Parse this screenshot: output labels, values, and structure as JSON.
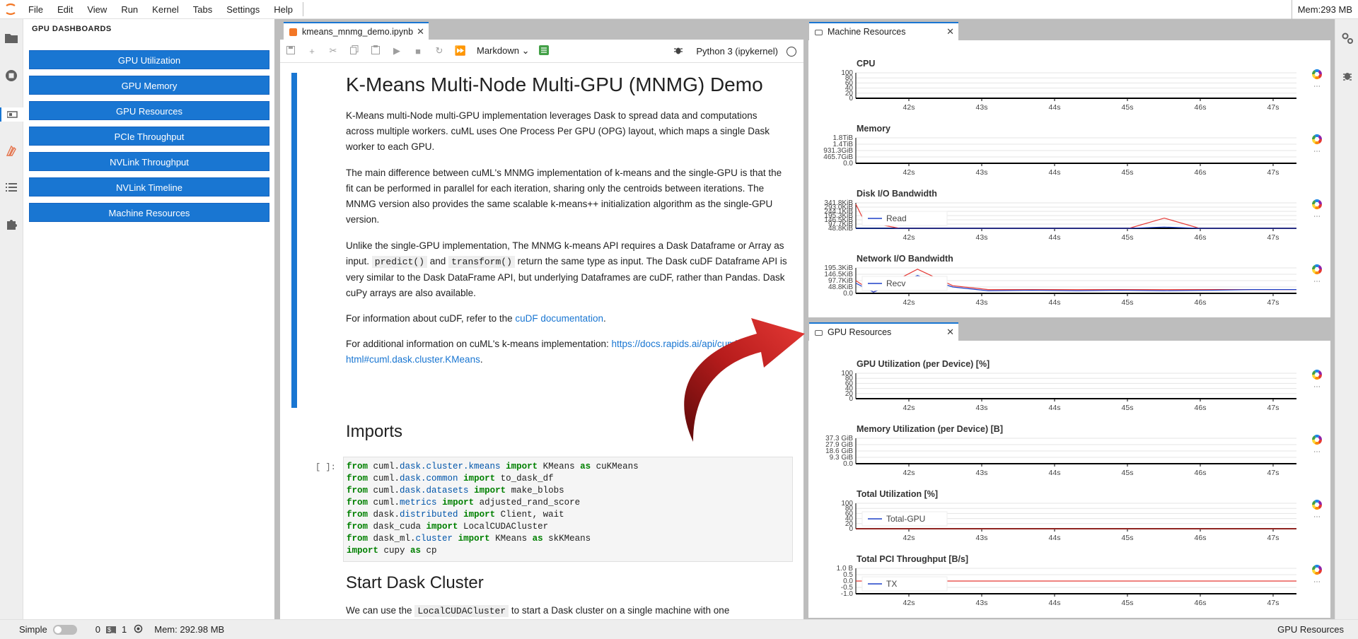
{
  "menubar": {
    "items": [
      "File",
      "Edit",
      "View",
      "Run",
      "Kernel",
      "Tabs",
      "Settings",
      "Help"
    ],
    "memory": "Mem:293 MB"
  },
  "left_panel": {
    "title": "GPU DASHBOARDS",
    "buttons": [
      "GPU Utilization",
      "GPU Memory",
      "GPU Resources",
      "PCIe Throughput",
      "NVLink Throughput",
      "NVLink Timeline",
      "Machine Resources"
    ]
  },
  "notebook": {
    "tab_label": "kmeans_mnmg_demo.ipynb",
    "cell_type": "Markdown",
    "kernel": "Python 3 (ipykernel)",
    "heading": "K-Means Multi-Node Multi-GPU (MNMG) Demo",
    "p1": "K-Means multi-Node multi-GPU implementation leverages Dask to spread data and computations across multiple workers. cuML uses One Process Per GPU (OPG) layout, which maps a single Dask worker to each GPU.",
    "p2": "The main difference between cuML's MNMG implementation of k-means and the single-GPU is that the fit can be performed in parallel for each iteration, sharing only the centroids between iterations. The MNMG version also provides the same scalable k-means++ initialization algorithm as the single-GPU version.",
    "p3_a": "Unlike the single-GPU implementation, The MNMG k-means API requires a Dask Dataframe or Array as input.",
    "p3_code1": "predict()",
    "p3_and": "and",
    "p3_code2": "transform()",
    "p3_b": "return the same type as input. The Dask cuDF Dataframe API is very similar to the Dask DataFrame API, but underlying Dataframes are cuDF, rather than Pandas. Dask cuPy arrays are also available.",
    "p4_a": "For information about cuDF, refer to the",
    "p4_link": "cuDF documentation",
    "p4_b": ".",
    "p5_a": "For additional information on cuML's k-means implementation:",
    "p5_link": "https://docs.rapids.ai/api/cuml/stable/api.html#cuml.dask.cluster.KMeans",
    "p5_b": ".",
    "h_imports": "Imports",
    "prompt": "[ ]:",
    "code_lines": [
      [
        "from",
        " cuml.",
        "dask.cluster.kmeans",
        " ",
        "import",
        " KMeans ",
        "as",
        " cuKMeans"
      ],
      [
        "from",
        " cuml.",
        "dask.common",
        " ",
        "import",
        " to_dask_df",
        "",
        ""
      ],
      [
        "from",
        " cuml.",
        "dask.datasets",
        " ",
        "import",
        " make_blobs",
        "",
        ""
      ],
      [
        "from",
        " cuml.",
        "metrics",
        " ",
        "import",
        " adjusted_rand_score",
        "",
        ""
      ],
      [
        "from",
        " dask.",
        "distributed",
        " ",
        "import",
        " Client, wait",
        "",
        ""
      ],
      [
        "from",
        " dask_cuda ",
        "",
        "",
        "import",
        " LocalCUDACluster",
        "",
        ""
      ],
      [
        "from",
        " dask_ml.",
        "cluster",
        " ",
        "import",
        " KMeans ",
        "as",
        " skKMeans"
      ],
      [
        "import",
        " cupy ",
        "",
        "",
        "as",
        " cp",
        "",
        ""
      ]
    ],
    "h_start": "Start Dask Cluster",
    "p6_a": "We can use the",
    "p6_code": "LocalCUDACluster",
    "p6_b": "to start a Dask cluster on a single machine with one"
  },
  "machine_resources": {
    "tab_label": "Machine Resources",
    "charts": [
      {
        "title": "CPU",
        "yticks": [
          "100",
          "80",
          "60",
          "40",
          "20",
          "0"
        ],
        "legend": ""
      },
      {
        "title": "Memory",
        "yticks": [
          "1.8TiB",
          "1.4TiB",
          "931.3GiB",
          "465.7GiB",
          "0.0"
        ],
        "legend": ""
      },
      {
        "title": "Disk I/O Bandwidth",
        "yticks": [
          "341.8KiB",
          "293.0KiB",
          "244.1KiB",
          "195.3KiB",
          "146.5KiB",
          "97.7KiB",
          "48.8KiB"
        ],
        "legend": "Read"
      },
      {
        "title": "Network I/O Bandwidth",
        "yticks": [
          "195.3KiB",
          "146.5KiB",
          "97.7KiB",
          "48.8KiB",
          "0.0"
        ],
        "legend": "Recv"
      }
    ],
    "xticks": [
      "42s",
      "43s",
      "44s",
      "45s",
      "46s",
      "47s"
    ]
  },
  "gpu_resources": {
    "tab_label": "GPU Resources",
    "charts": [
      {
        "title": "GPU Utilization (per Device) [%]",
        "yticks": [
          "100",
          "80",
          "60",
          "40",
          "20",
          "0"
        ],
        "legend": ""
      },
      {
        "title": "Memory Utilization (per Device) [B]",
        "yticks": [
          "37.3 GiB",
          "27.9 GiB",
          "18.6 GiB",
          "9.3 GiB",
          "0.0"
        ],
        "legend": ""
      },
      {
        "title": "Total Utilization [%]",
        "yticks": [
          "100",
          "80",
          "60",
          "40",
          "20",
          "0"
        ],
        "legend": "Total-GPU"
      },
      {
        "title": "Total PCI Throughput [B/s]",
        "yticks": [
          "1.0 B",
          "0.5",
          "0.0",
          "-0.5",
          "-1.0"
        ],
        "legend": "TX"
      }
    ],
    "xticks": [
      "42s",
      "43s",
      "44s",
      "45s",
      "46s",
      "47s"
    ]
  },
  "statusbar": {
    "mode": "Simple",
    "terminals": "0",
    "kernels": "1",
    "memory": "Mem: 292.98 MB",
    "right": "GPU Resources"
  },
  "colors": {
    "accent": "#1976d2",
    "line_red": "#e53935",
    "line_blue": "#1e40c8",
    "arrow": "#b71c1c"
  }
}
